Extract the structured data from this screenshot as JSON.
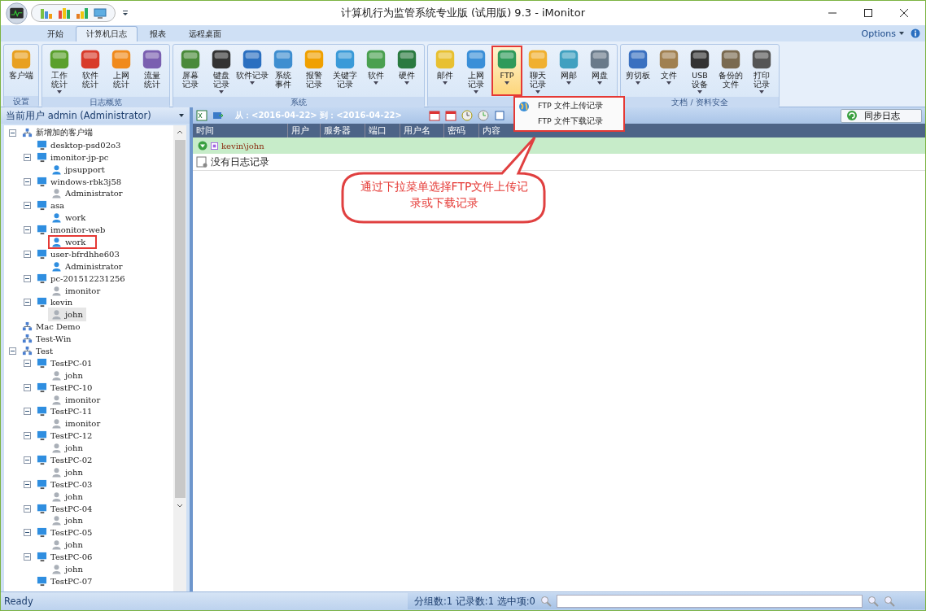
{
  "window": {
    "title": "计算机行为监管系统专业版 (试用版) 9.3 - iMonitor"
  },
  "ribbon_tabs": [
    {
      "label": "开始",
      "selected": false
    },
    {
      "label": "计算机日志",
      "selected": true
    },
    {
      "label": "报表",
      "selected": false
    },
    {
      "label": "远程桌面",
      "selected": false
    }
  ],
  "options_label": "Options",
  "ribbon_groups": [
    {
      "title": "设置",
      "buttons": [
        {
          "lines": [
            "客户端"
          ],
          "dropdown": false,
          "pressed": false,
          "marked": false
        }
      ]
    },
    {
      "title": "日志概览",
      "buttons": [
        {
          "lines": [
            "工作",
            "统计"
          ],
          "dropdown": true,
          "pressed": false,
          "marked": false
        },
        {
          "lines": [
            "软件",
            "统计"
          ],
          "dropdown": false,
          "pressed": false,
          "marked": false
        },
        {
          "lines": [
            "上网",
            "统计"
          ],
          "dropdown": false,
          "pressed": false,
          "marked": false
        },
        {
          "lines": [
            "流量",
            "统计"
          ],
          "dropdown": false,
          "pressed": false,
          "marked": false
        }
      ]
    },
    {
      "title": "系统",
      "buttons": [
        {
          "lines": [
            "屏幕",
            "记录"
          ],
          "dropdown": false,
          "pressed": false,
          "marked": false
        },
        {
          "lines": [
            "键盘",
            "记录"
          ],
          "dropdown": true,
          "pressed": false,
          "marked": false
        },
        {
          "lines": [
            "软件记录"
          ],
          "dropdown": true,
          "pressed": false,
          "marked": false
        },
        {
          "lines": [
            "系统",
            "事件"
          ],
          "dropdown": false,
          "pressed": false,
          "marked": false
        },
        {
          "lines": [
            "报警",
            "记录"
          ],
          "dropdown": false,
          "pressed": false,
          "marked": false
        },
        {
          "lines": [
            "关键字",
            "记录"
          ],
          "dropdown": false,
          "pressed": false,
          "marked": false
        },
        {
          "lines": [
            "软件"
          ],
          "dropdown": true,
          "pressed": false,
          "marked": false
        },
        {
          "lines": [
            "硬件"
          ],
          "dropdown": true,
          "pressed": false,
          "marked": false
        }
      ]
    },
    {
      "buttons": [
        {
          "lines": [
            "邮件"
          ],
          "dropdown": true,
          "pressed": false,
          "marked": false
        },
        {
          "lines": [
            "上网",
            "记录"
          ],
          "dropdown": true,
          "pressed": false,
          "marked": false
        },
        {
          "lines": [
            "FTP"
          ],
          "dropdown": true,
          "pressed": true,
          "marked": true
        },
        {
          "lines": [
            "聊天",
            "记录"
          ],
          "dropdown": true,
          "pressed": false,
          "marked": false
        },
        {
          "lines": [
            "网邮"
          ],
          "dropdown": true,
          "pressed": false,
          "marked": false
        },
        {
          "lines": [
            "网盘"
          ],
          "dropdown": true,
          "pressed": false,
          "marked": false
        }
      ]
    },
    {
      "title": "文档 / 资料安全",
      "buttons": [
        {
          "lines": [
            "剪切板"
          ],
          "dropdown": true,
          "pressed": false,
          "marked": false
        },
        {
          "lines": [
            "文件"
          ],
          "dropdown": true,
          "pressed": false,
          "marked": false
        },
        {
          "lines": [
            "USB",
            "设备"
          ],
          "dropdown": true,
          "pressed": false,
          "marked": false
        },
        {
          "lines": [
            "备份的",
            "文件"
          ],
          "dropdown": false,
          "pressed": false,
          "marked": false
        },
        {
          "lines": [
            "打印",
            "记录"
          ],
          "dropdown": true,
          "pressed": false,
          "marked": false
        }
      ]
    }
  ],
  "dropdown_menu": {
    "marked": true,
    "items": [
      {
        "label": "FTP 文件上传记录",
        "icon": true
      },
      {
        "label": "FTP 文件下载记录",
        "icon": false
      }
    ]
  },
  "sidebar": {
    "header": "当前用户 admin (Administrator)",
    "tree": [
      {
        "kind": "group",
        "label": "新增加的客户端",
        "selected": false,
        "marked": false,
        "children": [
          {
            "kind": "computer",
            "label": "desktop-psd02o3",
            "selected": false,
            "marked": false
          },
          {
            "kind": "computer",
            "label": "imonitor-jp-pc",
            "selected": false,
            "marked": false,
            "children": [
              {
                "kind": "user",
                "label": "jpsupport",
                "online": true,
                "selected": false,
                "marked": false
              }
            ]
          },
          {
            "kind": "computer",
            "label": "windows-rbk3j58",
            "selected": false,
            "marked": false,
            "children": [
              {
                "kind": "user",
                "label": "Administrator",
                "online": false,
                "selected": false,
                "marked": false
              }
            ]
          },
          {
            "kind": "computer",
            "label": "asa",
            "selected": false,
            "marked": false,
            "children": [
              {
                "kind": "user",
                "label": "work",
                "online": true,
                "selected": false,
                "marked": false
              }
            ]
          },
          {
            "kind": "computer",
            "label": "imonitor-web",
            "selected": false,
            "marked": false,
            "children": [
              {
                "kind": "user",
                "label": "work",
                "online": true,
                "selected": false,
                "marked": true
              }
            ]
          },
          {
            "kind": "computer",
            "label": "user-bfrdhhe603",
            "selected": false,
            "marked": false,
            "children": [
              {
                "kind": "user",
                "label": "Administrator",
                "online": true,
                "selected": false,
                "marked": false
              }
            ]
          },
          {
            "kind": "computer",
            "label": "pc-201512231256",
            "selected": false,
            "marked": false,
            "children": [
              {
                "kind": "user",
                "label": "imonitor",
                "online": false,
                "selected": false,
                "marked": false
              }
            ]
          },
          {
            "kind": "computer",
            "label": "kevin",
            "selected": false,
            "marked": false,
            "children": [
              {
                "kind": "user",
                "label": "john",
                "online": false,
                "selected": true,
                "marked": false
              }
            ]
          }
        ]
      },
      {
        "kind": "group",
        "label": "Mac Demo",
        "selected": false,
        "marked": false
      },
      {
        "kind": "group",
        "label": "Test-Win",
        "selected": false,
        "marked": false
      },
      {
        "kind": "group",
        "label": "Test",
        "selected": false,
        "marked": false,
        "children": [
          {
            "kind": "computer",
            "label": "TestPC-01",
            "selected": false,
            "marked": false,
            "children": [
              {
                "kind": "user",
                "label": "john",
                "online": false,
                "selected": false,
                "marked": false
              }
            ]
          },
          {
            "kind": "computer",
            "label": "TestPC-10",
            "selected": false,
            "marked": false,
            "children": [
              {
                "kind": "user",
                "label": "imonitor",
                "online": false,
                "selected": false,
                "marked": false
              }
            ]
          },
          {
            "kind": "computer",
            "label": "TestPC-11",
            "selected": false,
            "marked": false,
            "children": [
              {
                "kind": "user",
                "label": "imonitor",
                "online": false,
                "selected": false,
                "marked": false
              }
            ]
          },
          {
            "kind": "computer",
            "label": "TestPC-12",
            "selected": false,
            "marked": false,
            "children": [
              {
                "kind": "user",
                "label": "john",
                "online": false,
                "selected": false,
                "marked": false
              }
            ]
          },
          {
            "kind": "computer",
            "label": "TestPC-02",
            "selected": false,
            "marked": false,
            "children": [
              {
                "kind": "user",
                "label": "john",
                "online": false,
                "selected": false,
                "marked": false
              }
            ]
          },
          {
            "kind": "computer",
            "label": "TestPC-03",
            "selected": false,
            "marked": false,
            "children": [
              {
                "kind": "user",
                "label": "john",
                "online": false,
                "selected": false,
                "marked": false
              }
            ]
          },
          {
            "kind": "computer",
            "label": "TestPC-04",
            "selected": false,
            "marked": false,
            "children": [
              {
                "kind": "user",
                "label": "john",
                "online": false,
                "selected": false,
                "marked": false
              }
            ]
          },
          {
            "kind": "computer",
            "label": "TestPC-05",
            "selected": false,
            "marked": false,
            "children": [
              {
                "kind": "user",
                "label": "john",
                "online": false,
                "selected": false,
                "marked": false
              }
            ]
          },
          {
            "kind": "computer",
            "label": "TestPC-06",
            "selected": false,
            "marked": false,
            "children": [
              {
                "kind": "user",
                "label": "john",
                "online": false,
                "selected": false,
                "marked": false
              }
            ]
          },
          {
            "kind": "computer",
            "label": "TestPC-07",
            "selected": false,
            "marked": false
          }
        ]
      }
    ]
  },
  "log_toolbar": {
    "date_range": "从：<2016-04-22> 到：<2016-04-22>",
    "sync_button": "同步日志"
  },
  "table": {
    "columns": [
      "时间",
      "用户",
      "服务器",
      "端口",
      "用户名",
      "密码",
      "内容"
    ],
    "group_row": {
      "label": "kevin\\john",
      "expanded": true
    },
    "rows": [
      {
        "text": "没有日志记录"
      }
    ]
  },
  "callout": {
    "text": "通过下拉菜单选择FTP文件上传记录或下载记录"
  },
  "status_bar": {
    "status": "Ready",
    "counts": "分组数:1 记录数:1 选中项:0"
  }
}
